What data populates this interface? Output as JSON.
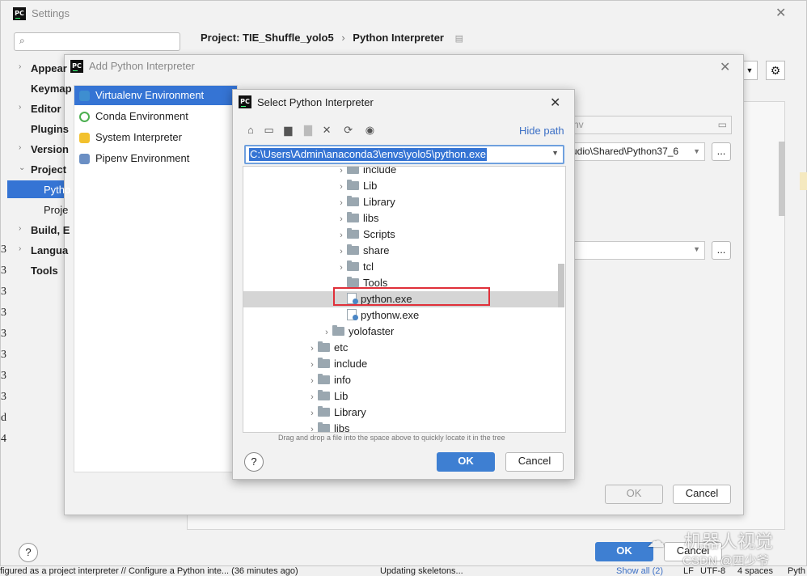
{
  "settings": {
    "title": "Settings",
    "search_placeholder": "",
    "breadcrumb_project": "Project: TIE_Shuffle_yolo5",
    "breadcrumb_page": "Python Interpreter",
    "tree_items": [
      "Appear",
      "Keymap",
      "Editor",
      "Plugins",
      "Version",
      "Project",
      "Pytho",
      "Proje",
      "Build, E",
      "Langua",
      "Tools"
    ],
    "ok_label": "OK",
    "cancel_label": "Cancel",
    "partial_path_1": "nv",
    "partial_path_2": "udio\\Shared\\Python37_6",
    "browse_label": "...",
    "left_edge_text": [
      "3",
      "3",
      "3",
      "3",
      "3",
      "3",
      "3",
      "3",
      "d",
      "4"
    ],
    "status_left": "figured as a project interpreter // Configure a Python inte... (36 minutes ago)",
    "status_middle": "Updating skeletons...",
    "status_right": [
      "Show all (2)",
      "LF",
      "UTF-8",
      "4 spaces",
      "Pyth"
    ]
  },
  "add_dialog": {
    "title": "Add Python Interpreter",
    "env_items": [
      {
        "label": "Virtualenv Environment",
        "icon": "virtualenv-icon"
      },
      {
        "label": "Conda Environment",
        "icon": "conda-icon"
      },
      {
        "label": "System Interpreter",
        "icon": "python-icon"
      },
      {
        "label": "Pipenv Environment",
        "icon": "pipenv-icon"
      }
    ],
    "ok_label": "OK",
    "cancel_label": "Cancel"
  },
  "select_dialog": {
    "title": "Select Python Interpreter",
    "hide_path_label": "Hide path",
    "path_value": "C:\\Users\\Admin\\anaconda3\\envs\\yolo5\\python.exe",
    "tree": [
      {
        "label": "include",
        "type": "folder",
        "level": 2,
        "expandable": true
      },
      {
        "label": "Lib",
        "type": "folder",
        "level": 2,
        "expandable": true
      },
      {
        "label": "Library",
        "type": "folder",
        "level": 2,
        "expandable": true
      },
      {
        "label": "libs",
        "type": "folder",
        "level": 2,
        "expandable": true
      },
      {
        "label": "Scripts",
        "type": "folder",
        "level": 2,
        "expandable": true
      },
      {
        "label": "share",
        "type": "folder",
        "level": 2,
        "expandable": true
      },
      {
        "label": "tcl",
        "type": "folder",
        "level": 2,
        "expandable": true
      },
      {
        "label": "Tools",
        "type": "folder",
        "level": 2,
        "expandable": false
      },
      {
        "label": "python.exe",
        "type": "file",
        "level": 2,
        "selected": true
      },
      {
        "label": "pythonw.exe",
        "type": "file",
        "level": 2
      },
      {
        "label": "yolofaster",
        "type": "folder",
        "level": 1,
        "expandable": true
      },
      {
        "label": "etc",
        "type": "folder",
        "level": 0,
        "expandable": true
      },
      {
        "label": "include",
        "type": "folder",
        "level": 0,
        "expandable": true
      },
      {
        "label": "info",
        "type": "folder",
        "level": 0,
        "expandable": true
      },
      {
        "label": "Lib",
        "type": "folder",
        "level": 0,
        "expandable": true
      },
      {
        "label": "Library",
        "type": "folder",
        "level": 0,
        "expandable": true
      },
      {
        "label": "libs",
        "type": "folder",
        "level": 0,
        "expandable": true
      }
    ],
    "hint": "Drag and drop a file into the space above to quickly locate it in the tree",
    "ok_label": "OK",
    "cancel_label": "Cancel",
    "help_label": "?"
  },
  "watermark": {
    "line1": "机器人视觉",
    "line2": "CSDN @四少爷"
  },
  "colors": {
    "accent": "#3e7fd2",
    "selection": "#3574d4",
    "highlight_box": "#e0303a"
  }
}
